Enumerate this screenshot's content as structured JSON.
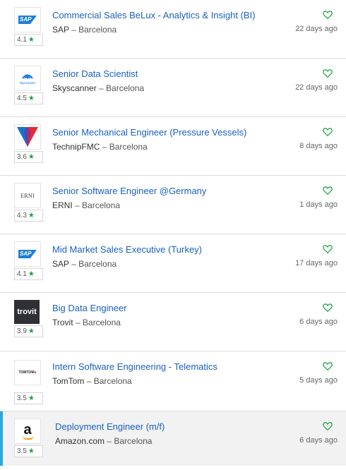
{
  "jobs": [
    {
      "title": "Commercial Sales BeLux - Analytics & Insight (BI)",
      "company": "SAP",
      "location": "Barcelona",
      "rating": "4.1",
      "age": "22 days ago",
      "logo": "sap-logo"
    },
    {
      "title": "Senior Data Scientist",
      "company": "Skyscanner",
      "location": "Barcelona",
      "rating": "4.5",
      "age": "22 days ago",
      "logo": "skyscanner-logo"
    },
    {
      "title": "Senior Mechanical Engineer (Pressure Vessels)",
      "company": "TechnipFMC",
      "location": "Barcelona",
      "rating": "3.6",
      "age": "8 days ago",
      "logo": "technipfmc-logo"
    },
    {
      "title": "Senior Software Engineer @Germany",
      "company": "ERNI",
      "location": "Barcelona",
      "rating": "4.3",
      "age": "1 days ago",
      "logo": "erni-logo"
    },
    {
      "title": "Mid Market Sales Executive (Turkey)",
      "company": "SAP",
      "location": "Barcelona",
      "rating": "4.1",
      "age": "17 days ago",
      "logo": "sap-logo"
    },
    {
      "title": "Big Data Engineer",
      "company": "Trovit",
      "location": "Barcelona",
      "rating": "3.9",
      "age": "6 days ago",
      "logo": "trovit-logo"
    },
    {
      "title": "Intern Software Engineering - Telematics",
      "company": "TomTom",
      "location": "Barcelona",
      "rating": "3.5",
      "age": "5 days ago",
      "logo": "tomtom-logo"
    },
    {
      "title": "Deployment Engineer (m/f)",
      "company": "Amazon.com",
      "location": "Barcelona",
      "rating": "3.5",
      "age": "6 days ago",
      "logo": "amazon-logo",
      "selected": true
    }
  ],
  "separator": " – ",
  "star_glyph": "★",
  "logo_text": {
    "sap": "SAP",
    "erni": "ERNI",
    "trovit": "trovit",
    "tomtom": "TOMTOM",
    "amazon": "a",
    "skyscanner": "skyscanner"
  },
  "colors": {
    "title_link": "#1861bf",
    "star": "#19a33a",
    "heart": "#19a33a",
    "selected_bar": "#28a9e1"
  }
}
